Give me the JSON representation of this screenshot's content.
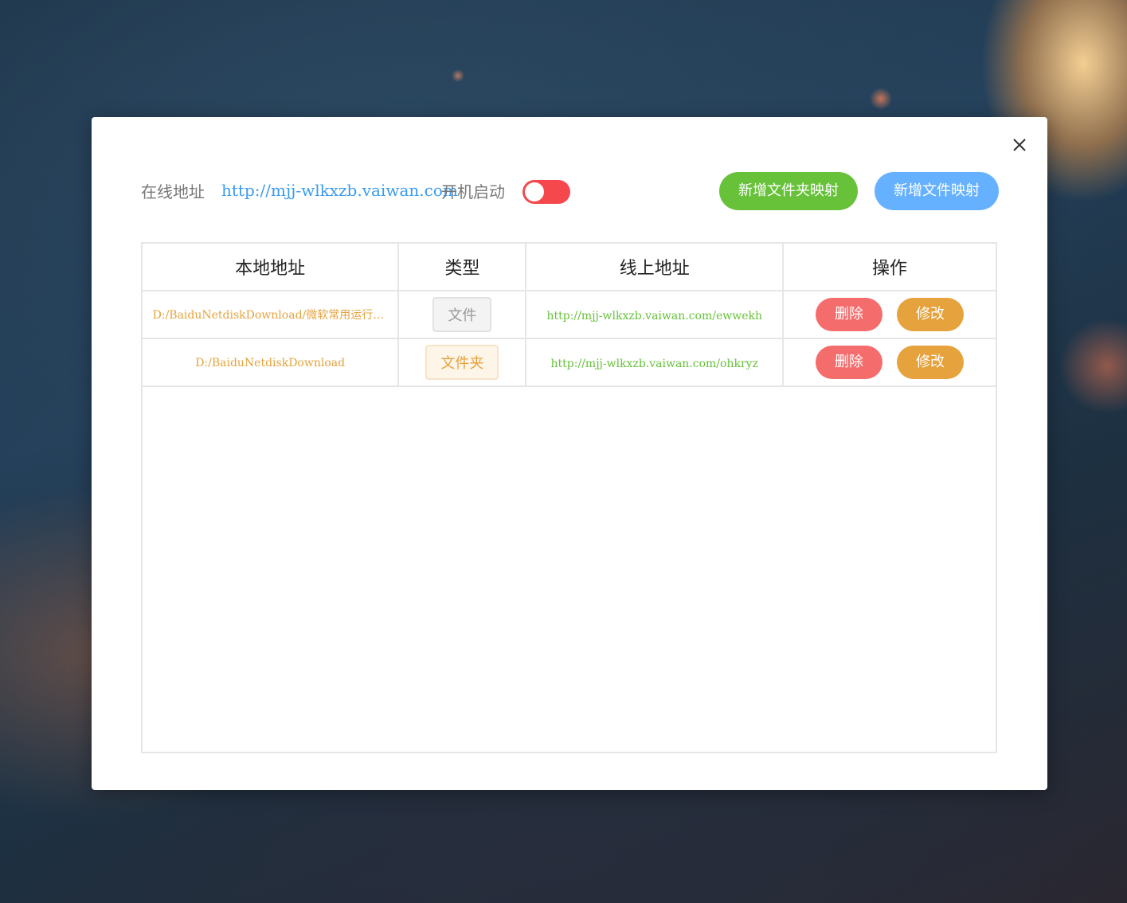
{
  "colors": {
    "toggle_off": "#f5484d",
    "add_folder_btn": "#67c23a",
    "add_file_btn": "#66b1ff",
    "delete_btn": "#f56c6c",
    "edit_btn": "#e6a23c",
    "link_blue": "#3a9bef",
    "path_orange": "#e6a23c",
    "url_green": "#67c23a"
  },
  "topbar": {
    "online_label": "在线地址",
    "online_url": "http://mjj-wlkxzb.vaiwan.com",
    "startup_label": "开机启动",
    "startup_enabled": false,
    "add_folder_button": "新增文件夹映射",
    "add_file_button": "新增文件映射"
  },
  "table": {
    "headers": [
      "本地地址",
      "类型",
      "线上地址",
      "操作"
    ],
    "rows": [
      {
        "local_path": "D:/BaiduNetdiskDownload/微软常用运行库...",
        "type": "文件",
        "online_url": "http://mjj-wlkxzb.vaiwan.com/ewwekh",
        "delete_label": "删除",
        "edit_label": "修改"
      },
      {
        "local_path": "D:/BaiduNetdiskDownload",
        "type": "文件夹",
        "online_url": "http://mjj-wlkxzb.vaiwan.com/ohkryz",
        "delete_label": "删除",
        "edit_label": "修改"
      }
    ]
  },
  "icons": {
    "close": "close-icon"
  }
}
